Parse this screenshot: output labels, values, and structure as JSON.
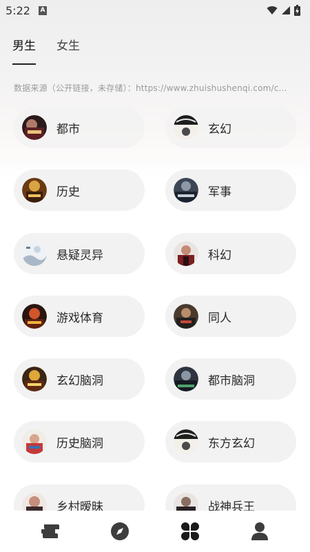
{
  "status_bar": {
    "time": "5:22",
    "icons": [
      "a-notification-icon",
      "wifi-icon",
      "signal-icon",
      "battery-icon"
    ]
  },
  "tabs": [
    {
      "label": "男生",
      "active": true
    },
    {
      "label": "女生",
      "active": false
    }
  ],
  "source_text": "数据来源（公开链接，未存储）：https://www.zhuishushenqi.com/c...",
  "categories": [
    {
      "label": "都市",
      "cover": "cover-dushi"
    },
    {
      "label": "玄幻",
      "cover": "cover-xuanhuan"
    },
    {
      "label": "历史",
      "cover": "cover-lishi"
    },
    {
      "label": "军事",
      "cover": "cover-junshi"
    },
    {
      "label": "悬疑灵异",
      "cover": "cover-xuanyi"
    },
    {
      "label": "科幻",
      "cover": "cover-kehuan"
    },
    {
      "label": "游戏体育",
      "cover": "cover-youxi"
    },
    {
      "label": "同人",
      "cover": "cover-tongren"
    },
    {
      "label": "玄幻脑洞",
      "cover": "cover-xuanhuan-naodong"
    },
    {
      "label": "都市脑洞",
      "cover": "cover-dushi-naodong"
    },
    {
      "label": "历史脑洞",
      "cover": "cover-lishi-naodong"
    },
    {
      "label": "东方玄幻",
      "cover": "cover-dongfang"
    },
    {
      "label": "乡村暧昧",
      "cover": "cover-xiangcun"
    },
    {
      "label": "战神兵王",
      "cover": "cover-zhanshen"
    }
  ],
  "bottom_nav": [
    {
      "icon": "bookshelf-icon",
      "active": false
    },
    {
      "icon": "compass-icon",
      "active": false
    },
    {
      "icon": "category-icon",
      "active": true
    },
    {
      "icon": "profile-icon",
      "active": false
    }
  ],
  "colors": {
    "pill_bg": "#f2f2f2",
    "nav_icon": "#3d3d3d",
    "text_primary": "#2a2a2a",
    "text_muted": "#9a9a9a"
  }
}
